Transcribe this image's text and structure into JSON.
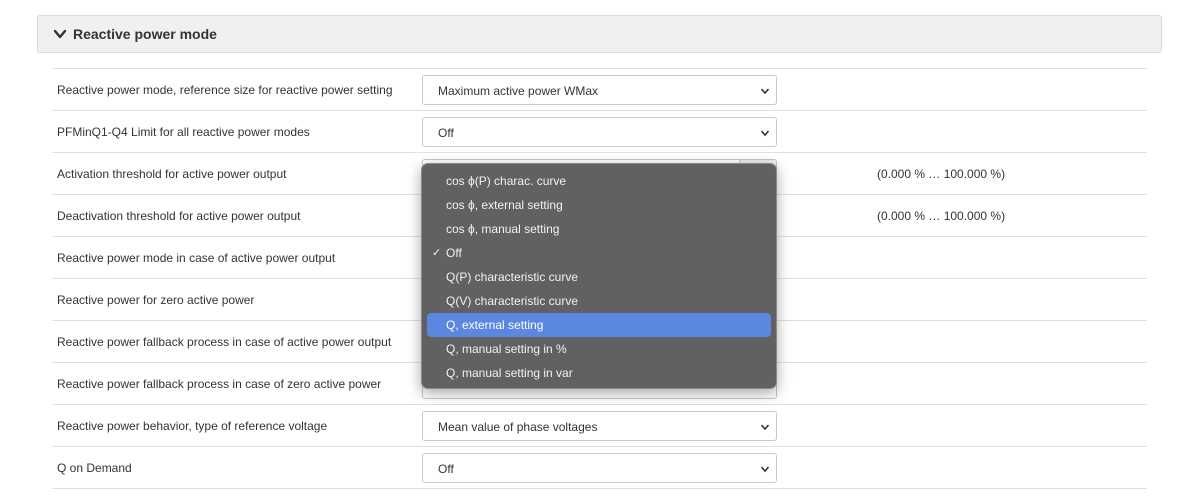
{
  "section": {
    "title": "Reactive power mode"
  },
  "rows": [
    {
      "label": "Reactive power mode, reference size for reactive power setting",
      "value": "Maximum active power WMax"
    },
    {
      "label": "PFMinQ1-Q4 Limit for all reactive power modes",
      "value": "Off"
    },
    {
      "label": "Activation threshold for active power output",
      "range": "(0.000 % … 100.000 %)"
    },
    {
      "label": "Deactivation threshold for active power output",
      "range": "(0.000 % … 100.000 %)"
    },
    {
      "label": "Reactive power mode in case of active power output"
    },
    {
      "label": "Reactive power for zero active power"
    },
    {
      "label": "Reactive power fallback process in case of active power output"
    },
    {
      "label": "Reactive power fallback process in case of zero active power"
    },
    {
      "label": "Reactive power behavior, type of reference voltage",
      "value": "Mean value of phase voltages"
    },
    {
      "label": "Q on Demand",
      "value": "Off"
    }
  ],
  "dropdown": {
    "options": [
      "cos ϕ(P) charac. curve",
      "cos ϕ, external setting",
      "cos ϕ, manual setting",
      "Off",
      "Q(P) characteristic curve",
      "Q(V) characteristic curve",
      "Q, external setting",
      "Q, manual setting in %",
      "Q, manual setting in var"
    ],
    "selected": "Off",
    "highlighted": "Q, external setting",
    "check_glyph": "✓"
  },
  "colors": {
    "highlight": "#5b87e0",
    "menu_bg": "#5c5c5c",
    "header_bg": "#f0f0f0"
  }
}
